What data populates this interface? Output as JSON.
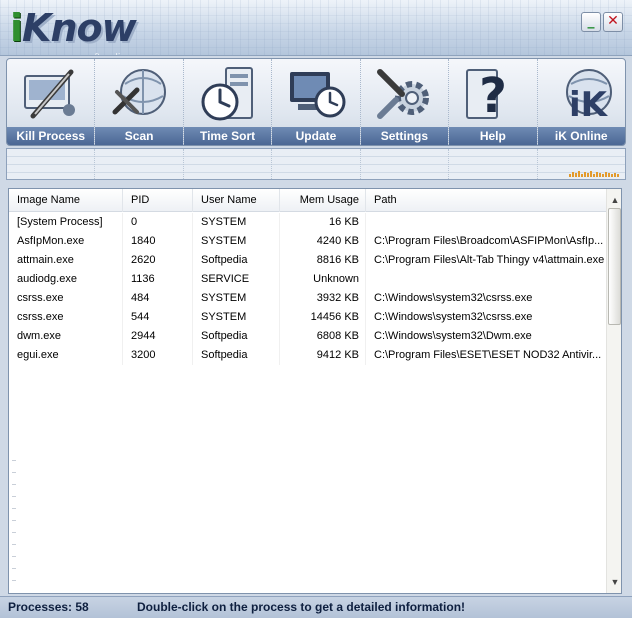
{
  "app": {
    "logo_i": "i",
    "logo_rest": "Know",
    "watermark": "www.softpedia.com",
    "minimize_label": "_",
    "close_label": "✕"
  },
  "toolbar": [
    {
      "label": "Kill Process",
      "icon": "kill-process-icon"
    },
    {
      "label": "Scan",
      "icon": "scan-icon"
    },
    {
      "label": "Time Sort",
      "icon": "time-sort-icon"
    },
    {
      "label": "Update",
      "icon": "update-icon"
    },
    {
      "label": "Settings",
      "icon": "settings-icon"
    },
    {
      "label": "Help",
      "icon": "help-icon"
    },
    {
      "label": "iK Online",
      "icon": "ik-online-icon"
    }
  ],
  "table": {
    "headers": {
      "name": "Image Name",
      "pid": "PID",
      "user": "User Name",
      "mem": "Mem Usage",
      "path": "Path"
    },
    "rows": [
      {
        "name": "[System Process]",
        "pid": "0",
        "user": "SYSTEM",
        "mem": "16 KB",
        "path": ""
      },
      {
        "name": "AsfIpMon.exe",
        "pid": "1840",
        "user": "SYSTEM",
        "mem": "4240 KB",
        "path": "C:\\Program Files\\Broadcom\\ASFIPMon\\AsfIp..."
      },
      {
        "name": "attmain.exe",
        "pid": "2620",
        "user": "Softpedia",
        "mem": "8816 KB",
        "path": "C:\\Program Files\\Alt-Tab Thingy v4\\attmain.exe"
      },
      {
        "name": "audiodg.exe",
        "pid": "1136",
        "user": "SERVICE",
        "mem": "Unknown",
        "path": ""
      },
      {
        "name": "csrss.exe",
        "pid": "484",
        "user": "SYSTEM",
        "mem": "3932 KB",
        "path": "C:\\Windows\\system32\\csrss.exe"
      },
      {
        "name": "csrss.exe",
        "pid": "544",
        "user": "SYSTEM",
        "mem": "14456 KB",
        "path": "C:\\Windows\\system32\\csrss.exe"
      },
      {
        "name": "dwm.exe",
        "pid": "2944",
        "user": "Softpedia",
        "mem": "6808 KB",
        "path": "C:\\Windows\\system32\\Dwm.exe"
      },
      {
        "name": "egui.exe",
        "pid": "3200",
        "user": "Softpedia",
        "mem": "9412 KB",
        "path": "C:\\Program Files\\ESET\\ESET NOD32 Antivir..."
      }
    ]
  },
  "status": {
    "count": "Processes: 58",
    "message": "Double-click on the process to get a detailed information!"
  },
  "colors": {
    "label_bar": "#4b6794",
    "status_text": "#0e1f3f",
    "minimize": "#1d8a2a",
    "close": "#c0141e"
  }
}
